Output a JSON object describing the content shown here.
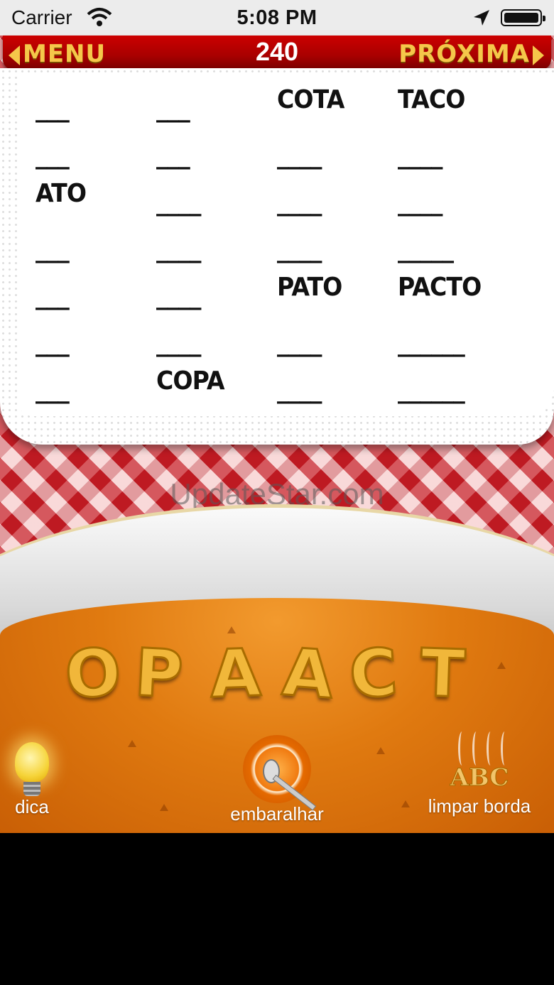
{
  "status_bar": {
    "carrier": "Carrier",
    "time": "5:08 PM"
  },
  "nav": {
    "menu_label": "MENU",
    "score": "240",
    "next_label": "PRÓXIMA"
  },
  "columns": [
    [
      "___",
      "___",
      "ATO",
      "___",
      "___",
      "___",
      "___"
    ],
    [
      "___",
      "___",
      "____",
      "____",
      "____",
      "____",
      "COPA"
    ],
    [
      "COTA",
      "____",
      "____",
      "____",
      "PATO",
      "____",
      "____"
    ],
    [
      "TACO",
      "____",
      "____",
      "_____",
      "PACTO",
      "______",
      "______"
    ]
  ],
  "watermark": "UpdateStar.com",
  "letters": [
    "O",
    "P",
    "A",
    "A",
    "C",
    "T"
  ],
  "tools": {
    "hint_label": "dica",
    "shuffle_label": "embaralhar",
    "clear_label": "limpar borda",
    "abc": "ABC"
  }
}
